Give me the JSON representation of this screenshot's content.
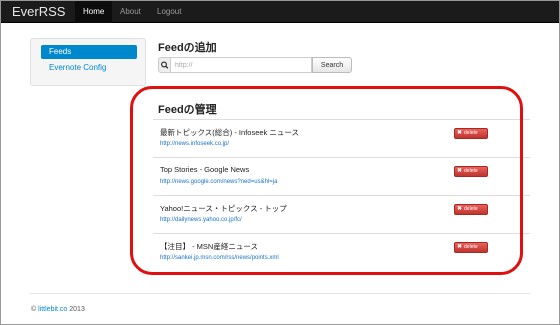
{
  "navbar": {
    "brand": "EverRSS",
    "items": [
      {
        "label": "Home",
        "active": true
      },
      {
        "label": "About",
        "active": false
      },
      {
        "label": "Logout",
        "active": false
      }
    ]
  },
  "sidebar": {
    "items": [
      {
        "label": "Feeds",
        "active": true
      },
      {
        "label": "Evernote Config",
        "active": false
      }
    ]
  },
  "add_section": {
    "title": "Feedの追加",
    "search_icon": "search-icon",
    "input_placeholder": "http://",
    "search_button": "Search"
  },
  "manage_section": {
    "title": "Feedの管理",
    "feeds": [
      {
        "name": "最新トピックス(総合) - Infoseek ニュース",
        "url": "http://news.infoseek.co.jp/",
        "delete_label": "delete"
      },
      {
        "name": "Top Stories - Google News",
        "url": "http://news.google.com/news?ned=us&hl=ja",
        "delete_label": "delete"
      },
      {
        "name": "Yahoo!ニュース・トピックス - トップ",
        "url": "http://dailynews.yahoo.co.jp/fc/",
        "delete_label": "delete"
      },
      {
        "name": "【注目】 - MSN産経ニュース",
        "url": "http://sankei.jp.msn.com/rss/news/points.xml",
        "delete_label": "delete"
      }
    ]
  },
  "footer": {
    "copyright": "©",
    "link": "littlebit.co",
    "year": "2013"
  },
  "colors": {
    "navbar": "#1b1b1b",
    "accent": "#0088cc",
    "danger": "#da4f49",
    "highlight": "#e01010"
  }
}
